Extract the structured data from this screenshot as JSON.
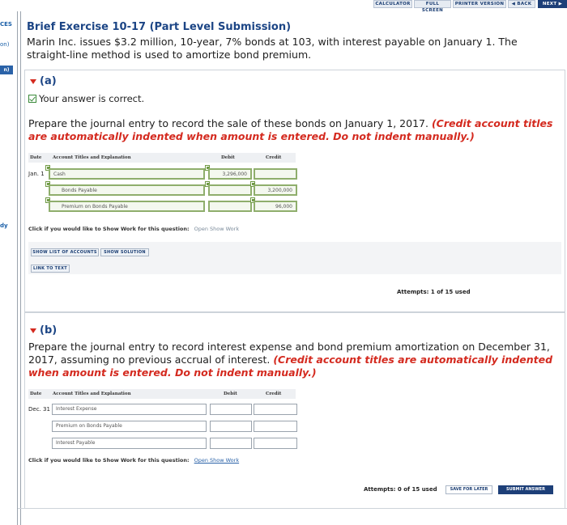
{
  "toolbar": {
    "calculator": "CALCULATOR",
    "full_screen": "FULL SCREEN",
    "printer_version": "PRINTER VERSION",
    "back": "◀ BACK",
    "next": "NEXT ▶"
  },
  "sidebar": {
    "label_top": "CES",
    "label_on": "on)",
    "tab_label": "n)",
    "label_dy": "dy"
  },
  "exercise": {
    "title": "Brief Exercise 10-17 (Part Level Submission)",
    "description": "Marin Inc. issues $3.2 million, 10-year, 7% bonds at 103, with interest payable on January 1. The straight-line method is used to amortize bond premium."
  },
  "part_a": {
    "label": "(a)",
    "status": "Your answer is correct.",
    "instruction": "Prepare the journal entry to record the sale of these bonds on January 1, 2017.",
    "instruction_note": "(Credit account titles are automatically indented when amount is entered. Do not indent manually.)",
    "headers": {
      "date": "Date",
      "account": "Account Titles and Explanation",
      "debit": "Debit",
      "credit": "Credit"
    },
    "rows": [
      {
        "date": "Jan. 1",
        "account": "Cash",
        "debit": "3,296,000",
        "credit": ""
      },
      {
        "date": "",
        "account": "Bonds Payable",
        "debit": "",
        "credit": "3,200,000"
      },
      {
        "date": "",
        "account": "Premium on Bonds Payable",
        "debit": "",
        "credit": "96,000"
      }
    ],
    "show_work_prompt": "Click if you would like to Show Work for this question:",
    "show_work_link": "Open Show Work",
    "show_accounts": "SHOW LIST OF ACCOUNTS",
    "show_solution": "SHOW SOLUTION",
    "link_to_text": "LINK TO TEXT",
    "attempts": "Attempts: 1 of 15 used"
  },
  "part_b": {
    "label": "(b)",
    "instruction": "Prepare the journal entry to record interest expense and bond premium amortization on December 31, 2017, assuming no previous accrual of interest.",
    "instruction_note": "(Credit account titles are automatically indented when amount is entered. Do not indent manually.)",
    "headers": {
      "date": "Date",
      "account": "Account Titles and Explanation",
      "debit": "Debit",
      "credit": "Credit"
    },
    "rows": [
      {
        "date": "Dec. 31",
        "account": "Interest Expense",
        "debit": "",
        "credit": ""
      },
      {
        "date": "",
        "account": "Premium on Bonds Payable",
        "debit": "",
        "credit": ""
      },
      {
        "date": "",
        "account": "Interest Payable",
        "debit": "",
        "credit": ""
      }
    ],
    "show_work_prompt": "Click if you would like to Show Work for this question:",
    "show_work_link": "Open Show Work",
    "attempts": "Attempts: 0 of 15 used",
    "save_for_later": "SAVE FOR LATER",
    "submit_answer": "SUBMIT ANSWER"
  }
}
